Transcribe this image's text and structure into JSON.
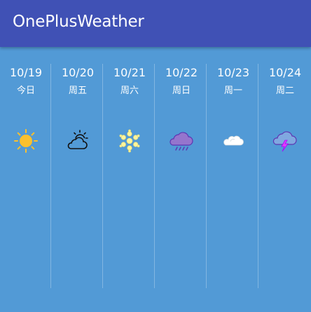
{
  "app": {
    "title": "OnePlusWeather"
  },
  "forecast": [
    {
      "date": "10/19",
      "weekday": "今日",
      "icon": "sunny-icon"
    },
    {
      "date": "10/20",
      "weekday": "周五",
      "icon": "partly-cloudy-icon"
    },
    {
      "date": "10/21",
      "weekday": "周六",
      "icon": "snow-icon"
    },
    {
      "date": "10/22",
      "weekday": "周日",
      "icon": "rain-icon"
    },
    {
      "date": "10/23",
      "weekday": "周一",
      "icon": "cloudy-icon"
    },
    {
      "date": "10/24",
      "weekday": "周二",
      "icon": "thunderstorm-icon"
    }
  ],
  "colors": {
    "toolbar": "#4051b5",
    "background": "#529ad6",
    "sun": "#fbc02d",
    "snow": "#fff59d",
    "rain_cloud": "#9575cd",
    "storm_cloud": "#80a8e0"
  }
}
